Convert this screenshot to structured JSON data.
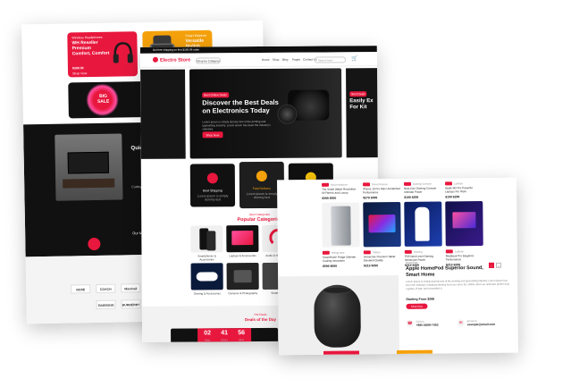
{
  "card1": {
    "promo1": {
      "small": "Wireless Headphones",
      "title": "WH Reseller Premium Comfort, Comfort",
      "price": "$399.00",
      "cta": "Shop Now"
    },
    "promo2": {
      "small": "Smart Watches",
      "title": "Versatile Stylish Elegance"
    },
    "promo3": {
      "badge": "BIG SALE"
    },
    "dark_title": "Quick Expe",
    "feature_text": "Cutting-edge Technology",
    "mid_label": "Our Most",
    "brands": [
      "BOSE",
      "COACH",
      "Marshall",
      "SAMSUNG",
      "BURBERRY"
    ]
  },
  "card2": {
    "topbar": "Get free shipping on first $199.99 order",
    "logo": "Electro Store",
    "category_button": "Shop by Category",
    "nav_links": [
      "Home",
      "Shop",
      "Blog",
      "Pages",
      "Contact Us"
    ],
    "search_placeholder": "Search here",
    "hero": {
      "tag": "Best Online Deals",
      "title": "Discover the Best Deals on Electronics Today",
      "desc": "Lorem ipsum is simply dummy text of the printing and typesetting industry. Lorem ipsum has been the industry's standard.",
      "cta": "Shop Now"
    },
    "hero_right": {
      "tag": "Best Deals",
      "title": "Easily Ex For Kit"
    },
    "features": [
      {
        "title": "Best Shipping",
        "desc": "Lorem ipsum is simply dummy text"
      },
      {
        "title": "Fast Delivery",
        "desc": "Lorem ipsum is simply dummy text"
      },
      {
        "title": "24/7 Support",
        "desc": "Lorem ipsum is simply dummy text"
      }
    ],
    "categories_small": "Best Categories",
    "categories_title": "Popular Categories",
    "categories": [
      "Smartphones & Accessories",
      "Laptops & Accessories",
      "Audio & Headphones",
      "Gaming & Accessories",
      "Cameras & Photography",
      "Smart Home"
    ],
    "deals_small": "Hot Deals",
    "deals_title": "Deals of the Day",
    "countdown": [
      {
        "num": "02",
        "label": "Days"
      },
      {
        "num": "41",
        "label": "Hours"
      },
      {
        "num": "56",
        "label": "Mins"
      },
      {
        "num": "19",
        "label": "Secs"
      }
    ]
  },
  "card3": {
    "products": [
      {
        "cat": "Smart Watches",
        "name": "The Smart Watch Revolution Of Fitness and Luxury",
        "price": "$399  $500"
      },
      {
        "cat": "Smart Phones",
        "name": "iPhone 15 Pro Max Unmatched Performance",
        "price": "$279  $399"
      },
      {
        "cat": "Gaming Console",
        "name": "Next-Gen Gaming Console Ultimate Power",
        "price": "$199  $299"
      },
      {
        "cat": "Laptops",
        "name": "Apple M2 Pro Powerful Laptops For Work",
        "price": "$199  $299"
      },
      {
        "cat": "Refrigerator",
        "name": "SmartHome Fridge Ultimate Cooling Innovation",
        "price": "$599  $699"
      },
      {
        "cat": "Tablets",
        "name": "Immersive Premium Tablet Elevated Quality",
        "price": "$219  $299"
      },
      {
        "cat": "Gaming",
        "name": "PS5 Next Level Gaming Immersive Power",
        "price": "$219  $299"
      },
      {
        "cat": "Laptops",
        "name": "MacBook Pro Elegance Performance",
        "price": "$219  $299"
      }
    ],
    "speaker": {
      "small": "HomePod",
      "title": "Apple HomePod Superior Sound, Smart Home",
      "desc": "Lorem ipsum is simply dummy text of the printing and typesetting industry. Lorem ipsum has been the industry's standard dummy text ever since the 1500s, when an unknown printer took a galley of type and scrambled it.",
      "price": "Starting From $299",
      "cta": "Shop Now"
    },
    "pager": [
      "‹",
      "›"
    ],
    "contact": [
      {
        "label": "Call Us",
        "value": "+880 16684 7452"
      },
      {
        "label": "Email Us",
        "value": "example@email.com"
      }
    ]
  },
  "colors": {
    "accent": "#e8173d",
    "orange": "#f5a10b",
    "dark": "#111111"
  }
}
